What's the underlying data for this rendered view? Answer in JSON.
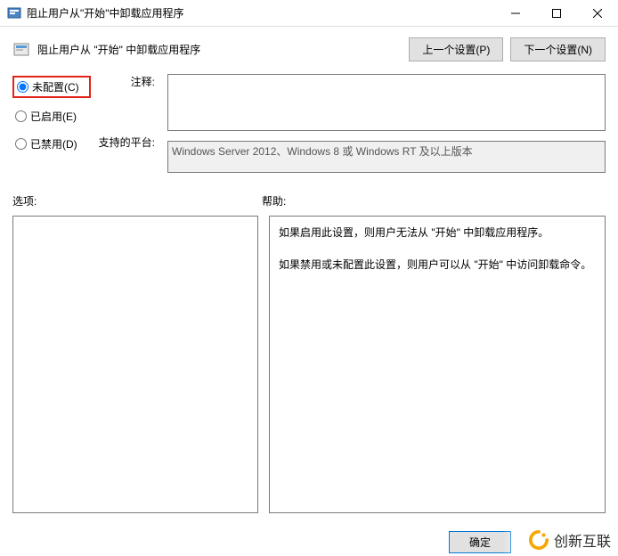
{
  "window": {
    "title": "阻止用户从\"开始\"中卸载应用程序",
    "minimize": "—",
    "maximize": "□",
    "close": "✕"
  },
  "header": {
    "title": "阻止用户从 \"开始\" 中卸载应用程序",
    "prev": "上一个设置(P)",
    "next": "下一个设置(N)"
  },
  "radios": {
    "not_configured": "未配置(C)",
    "enabled": "已启用(E)",
    "disabled": "已禁用(D)",
    "selected": "not_configured"
  },
  "labels": {
    "comment": "注释:",
    "platform": "支持的平台:",
    "options": "选项:",
    "help": "帮助:"
  },
  "fields": {
    "comment": "",
    "platform": "Windows Server 2012、Windows 8 或 Windows RT 及以上版本"
  },
  "help": {
    "p1": "如果启用此设置，则用户无法从 \"开始\" 中卸载应用程序。",
    "p2": "如果禁用或未配置此设置，则用户可以从 \"开始\" 中访问卸载命令。"
  },
  "footer": {
    "ok": "确定"
  },
  "watermark": {
    "text": "创新互联"
  }
}
